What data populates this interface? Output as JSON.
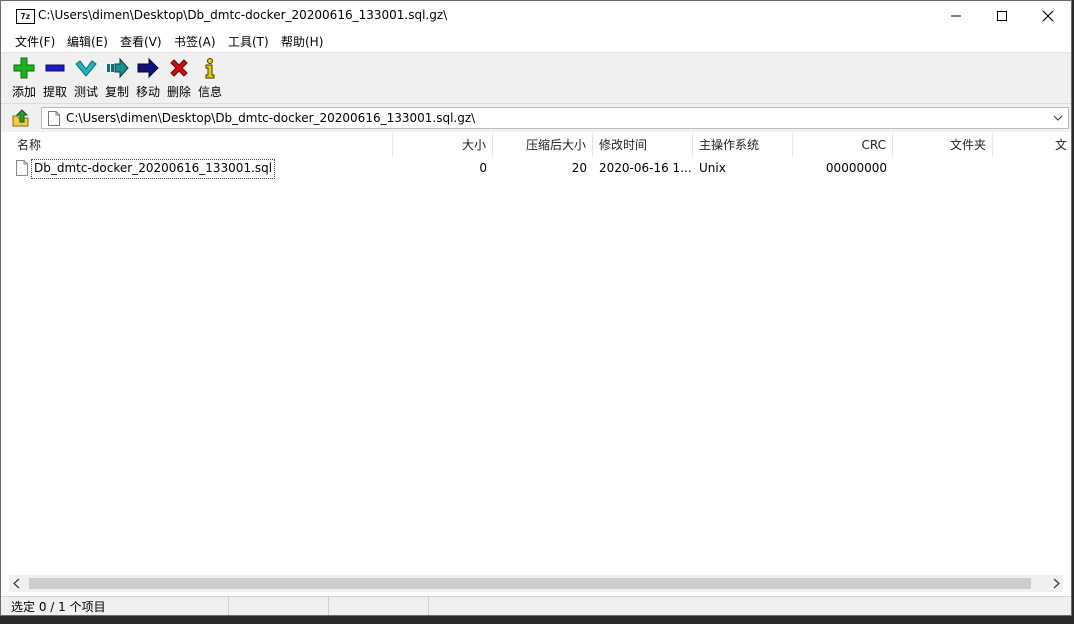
{
  "window": {
    "title": "C:\\Users\\dimen\\Desktop\\Db_dmtc-docker_20200616_133001.sql.gz\\",
    "app_icon_text": "7z"
  },
  "menu": [
    "文件(F)",
    "编辑(E)",
    "查看(V)",
    "书签(A)",
    "工具(T)",
    "帮助(H)"
  ],
  "toolbar": [
    {
      "label": "添加",
      "icon": "add-icon"
    },
    {
      "label": "提取",
      "icon": "extract-icon"
    },
    {
      "label": "测试",
      "icon": "test-icon"
    },
    {
      "label": "复制",
      "icon": "copy-icon"
    },
    {
      "label": "移动",
      "icon": "move-icon"
    },
    {
      "label": "删除",
      "icon": "delete-icon"
    },
    {
      "label": "信息",
      "icon": "info-icon"
    }
  ],
  "address": {
    "path": "C:\\Users\\dimen\\Desktop\\Db_dmtc-docker_20200616_133001.sql.gz\\"
  },
  "columns": [
    "名称",
    "大小",
    "压缩后大小",
    "修改时间",
    "主操作系统",
    "CRC",
    "文件夹",
    "文"
  ],
  "rows": [
    {
      "name": "Db_dmtc-docker_20200616_133001.sql",
      "size": "0",
      "packed": "20",
      "modified": "2020-06-16 1...",
      "host_os": "Unix",
      "crc": "00000000",
      "folder": ""
    }
  ],
  "status": {
    "selection": "选定 0 / 1 个项目"
  },
  "colors": {
    "add": "#1db31d",
    "extract": "#1c1cc8",
    "test": "#21b6c6",
    "copy": "#0f6f6f",
    "move": "#12127a",
    "delete": "#d01010",
    "info": "#c7b400"
  }
}
